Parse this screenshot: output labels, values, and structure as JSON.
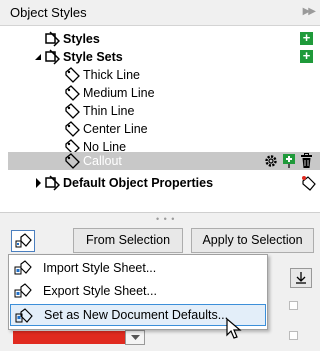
{
  "title": "Object Styles",
  "tree": [
    {
      "label": "Styles",
      "bold": true,
      "has_add": true
    },
    {
      "label": "Style Sets",
      "bold": true,
      "has_add": true,
      "expanded": true
    },
    {
      "label": "Thick Line"
    },
    {
      "label": "Medium Line"
    },
    {
      "label": "Thin Line"
    },
    {
      "label": "Center Line"
    },
    {
      "label": "No Line"
    },
    {
      "label": "Callout",
      "selected": true
    },
    {
      "label": "Default Object Properties",
      "bold": true
    }
  ],
  "buttons": {
    "from_selection": "From Selection",
    "apply_to_selection": "Apply to Selection"
  },
  "menu": [
    {
      "label": "Import Style Sheet..."
    },
    {
      "label": "Export Style Sheet..."
    },
    {
      "label": "Set as New Document Defaults...",
      "highlighted": true
    }
  ],
  "colors": {
    "add": "#1f9a3a",
    "selection": "#c8c8c8",
    "menu_highlight": "#e3eef9",
    "swatch": "#e02a1f"
  }
}
